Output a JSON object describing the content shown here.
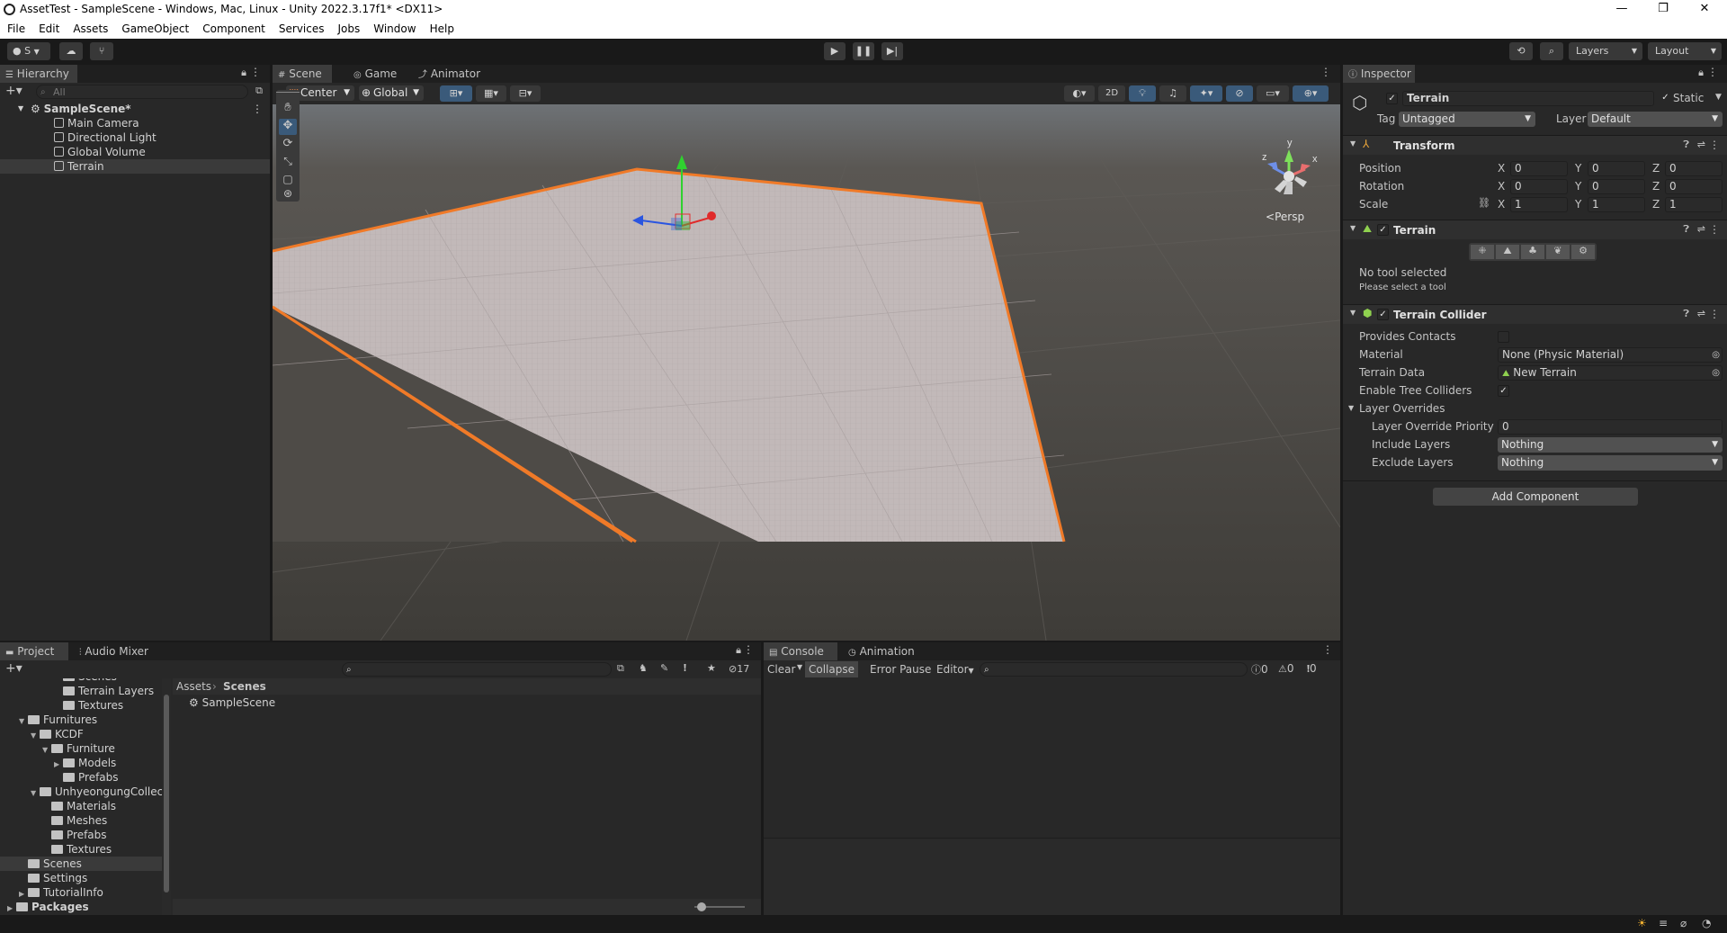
{
  "window": {
    "title": "AssetTest - SampleScene - Windows, Mac, Linux - Unity 2022.3.17f1* <DX11>",
    "minimize": "—",
    "maximize": "❐",
    "close": "✕"
  },
  "menu": [
    "File",
    "Edit",
    "Assets",
    "GameObject",
    "Component",
    "Services",
    "Jobs",
    "Window",
    "Help"
  ],
  "toolbar": {
    "account": "S",
    "layers_label": "Layers",
    "layout_label": "Layout"
  },
  "hierarchy": {
    "tab": "Hierarchy",
    "search_placeholder": "All",
    "scene_name": "SampleScene*",
    "items": [
      "Main Camera",
      "Directional Light",
      "Global Volume",
      "Terrain"
    ],
    "selected": "Terrain"
  },
  "scene_view": {
    "tabs": [
      "Scene",
      "Game",
      "Animator"
    ],
    "pivot": "Center",
    "space": "Global",
    "mode_2d": "2D",
    "persp_label": "Persp",
    "gizmo_axes": [
      "y",
      "z",
      "x"
    ]
  },
  "inspector": {
    "tab": "Inspector",
    "object_name": "Terrain",
    "static_label": "Static",
    "tag_label": "Tag",
    "tag_value": "Untagged",
    "layer_label": "Layer",
    "layer_value": "Default",
    "transform": {
      "title": "Transform",
      "position_label": "Position",
      "rotation_label": "Rotation",
      "scale_label": "Scale",
      "position": {
        "x": "0",
        "y": "0",
        "z": "0"
      },
      "rotation": {
        "x": "0",
        "y": "0",
        "z": "0"
      },
      "scale": {
        "x": "1",
        "y": "1",
        "z": "1"
      }
    },
    "terrain": {
      "title": "Terrain",
      "no_tool": "No tool selected",
      "hint": "Please select a tool"
    },
    "terrain_collider": {
      "title": "Terrain Collider",
      "provides_contacts": "Provides Contacts",
      "material_label": "Material",
      "material_value": "None (Physic Material)",
      "terrain_data_label": "Terrain Data",
      "terrain_data_value": "New Terrain",
      "enable_tree_colliders": "Enable Tree Colliders",
      "layer_overrides": "Layer Overrides",
      "layer_override_priority_label": "Layer Override Priority",
      "layer_override_priority_value": "0",
      "include_layers_label": "Include Layers",
      "include_layers_value": "Nothing",
      "exclude_layers_label": "Exclude Layers",
      "exclude_layers_value": "Nothing"
    },
    "add_component": "Add Component"
  },
  "project": {
    "tabs": [
      "Project",
      "Audio Mixer"
    ],
    "hidden_count": "17",
    "breadcrumb_root": "Assets",
    "breadcrumb_current": "Scenes",
    "tree": [
      {
        "label": "Scenes",
        "indent": 4,
        "arrow": ""
      },
      {
        "label": "Terrain Layers",
        "indent": 4,
        "arrow": ""
      },
      {
        "label": "Textures",
        "indent": 4,
        "arrow": ""
      },
      {
        "label": "Furnitures",
        "indent": 1,
        "arrow": "▼"
      },
      {
        "label": "KCDF",
        "indent": 2,
        "arrow": "▼"
      },
      {
        "label": "Furniture",
        "indent": 3,
        "arrow": "▼"
      },
      {
        "label": "Models",
        "indent": 4,
        "arrow": "▶"
      },
      {
        "label": "Prefabs",
        "indent": 4,
        "arrow": ""
      },
      {
        "label": "UnhyeongungCollec",
        "indent": 2,
        "arrow": "▼"
      },
      {
        "label": "Materials",
        "indent": 3,
        "arrow": ""
      },
      {
        "label": "Meshes",
        "indent": 3,
        "arrow": ""
      },
      {
        "label": "Prefabs",
        "indent": 3,
        "arrow": ""
      },
      {
        "label": "Textures",
        "indent": 3,
        "arrow": ""
      },
      {
        "label": "Scenes",
        "indent": 1,
        "arrow": ""
      },
      {
        "label": "Settings",
        "indent": 1,
        "arrow": ""
      },
      {
        "label": "TutorialInfo",
        "indent": 1,
        "arrow": "▶"
      },
      {
        "label": "Packages",
        "indent": 0,
        "arrow": "▶"
      }
    ],
    "files": [
      "SampleScene"
    ]
  },
  "console": {
    "tabs": [
      "Console",
      "Animation"
    ],
    "clear": "Clear",
    "collapse": "Collapse",
    "error_pause": "Error Pause",
    "editor": "Editor",
    "count_logs": "0",
    "count_warnings": "0",
    "count_errors": "0"
  }
}
